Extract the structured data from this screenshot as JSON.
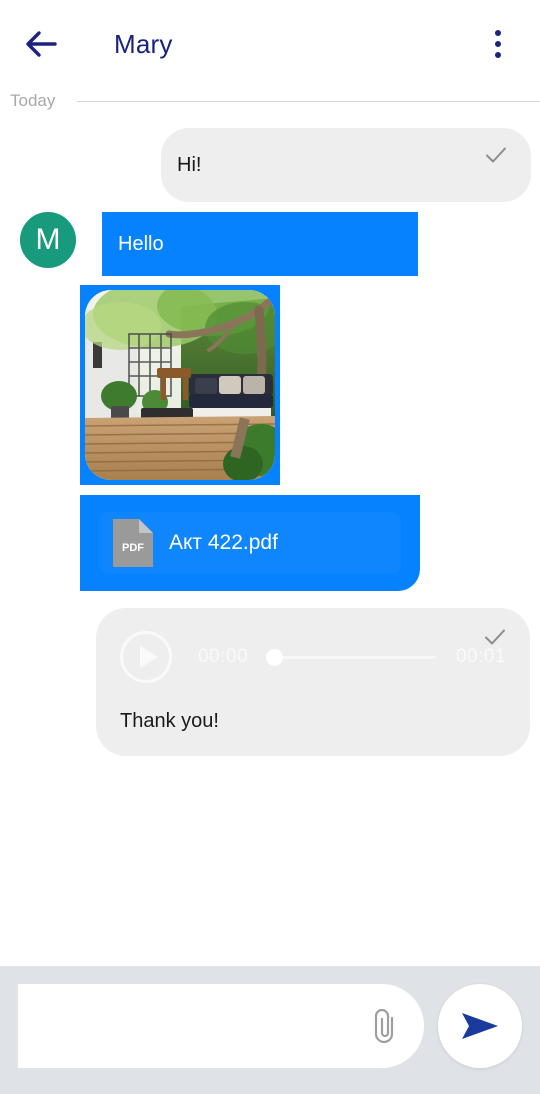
{
  "header": {
    "back_icon": "arrow-left-icon",
    "title": "Mary",
    "menu_icon": "overflow-menu-icon",
    "title_color": "#1a237e"
  },
  "day_divider": {
    "label": "Today"
  },
  "messages": [
    {
      "id": "m1",
      "direction": "outgoing",
      "type": "text",
      "text": "Hi!",
      "status_icon": "check-icon",
      "bubble_color": "#eeeeee",
      "text_color": "#1a1a1a"
    },
    {
      "id": "m2",
      "direction": "incoming",
      "type": "text",
      "text": "Hello",
      "avatar_letter": "M",
      "avatar_color": "#189a7c",
      "bubble_color": "#0682fe",
      "text_color": "#ffffff"
    },
    {
      "id": "m3",
      "direction": "incoming",
      "type": "image",
      "alt": "garden patio with wooden deck, sofa and tree canopy",
      "bubble_color": "#0682fe"
    },
    {
      "id": "m4",
      "direction": "incoming",
      "type": "file",
      "file_icon_label": "PDF",
      "file_name": "Акт 422.pdf",
      "bubble_color": "#0682fe",
      "card_color": "#0f86fd"
    },
    {
      "id": "m5",
      "direction": "outgoing",
      "type": "audio",
      "play_icon": "play-icon",
      "time_current": "00:00",
      "time_total": "00:01",
      "progress_percent": 0,
      "caption": "Thank you!",
      "status_icon": "check-icon",
      "bubble_color": "#eeeeee"
    }
  ],
  "composer": {
    "input_value": "",
    "input_placeholder": "",
    "attach_icon": "paperclip-icon",
    "send_icon": "send-icon",
    "send_icon_color": "#1a237e",
    "bar_color": "#dfe3e8"
  }
}
